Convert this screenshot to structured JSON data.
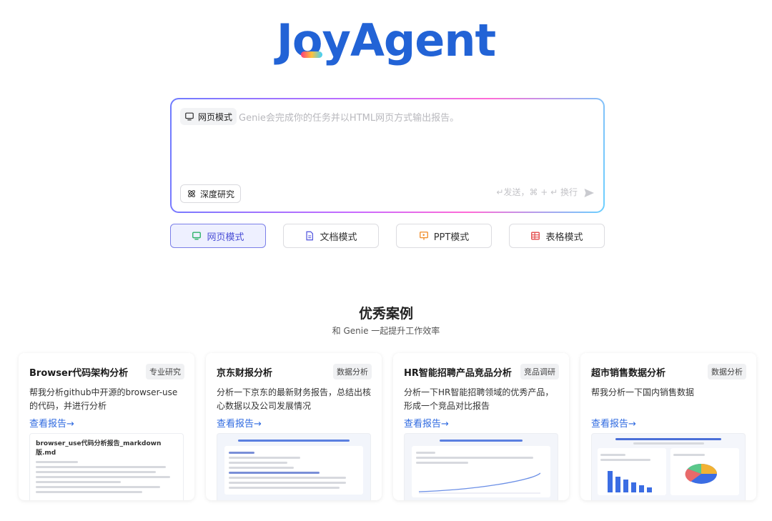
{
  "brand": {
    "name": "JoyAgent"
  },
  "input": {
    "mode_chip": "网页模式",
    "placeholder": "Genie会完成你的任务并以HTML网页方式输出报告。",
    "deep_research": "深度研究",
    "send_hint": "↵发送，⌘ + ↵ 换行"
  },
  "modes": [
    {
      "label": "网页模式",
      "icon": "monitor-icon",
      "color": "#2fb36a",
      "active": true
    },
    {
      "label": "文档模式",
      "icon": "document-icon",
      "color": "#5b5fe0",
      "active": false
    },
    {
      "label": "PPT模式",
      "icon": "presentation-icon",
      "color": "#f08a24",
      "active": false
    },
    {
      "label": "表格模式",
      "icon": "table-icon",
      "color": "#e34848",
      "active": false
    }
  ],
  "showcase": {
    "title": "优秀案例",
    "subtitle": "和 Genie 一起提升工作效率"
  },
  "cards": [
    {
      "title": "Browser代码架构分析",
      "tag": "专业研究",
      "desc": "帮我分析github中开源的browser-use的代码，并进行分析",
      "link": "查看报告→",
      "preview_heading": "browser_use代码分析报告_markdown版.md"
    },
    {
      "title": "京东财报分析",
      "tag": "数据分析",
      "desc": "分析一下京东的最新财务报告，总结出核心数据以及公司发展情况",
      "link": "查看报告→"
    },
    {
      "title": "HR智能招聘产品竞品分析",
      "tag": "竞品调研",
      "desc": "分析一下HR智能招聘领域的优秀产品，形成一个竞品对比报告",
      "link": "查看报告→"
    },
    {
      "title": "超市销售数据分析",
      "tag": "数据分析",
      "desc": "帮我分析一下国内销售数据",
      "link": "查看报告→"
    }
  ],
  "accent": "#2263d6"
}
